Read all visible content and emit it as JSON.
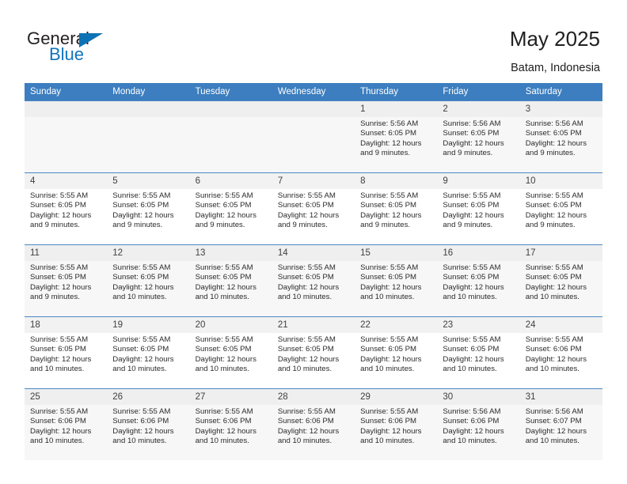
{
  "brand": {
    "name_top": "General",
    "name_bottom": "Blue",
    "triangle_color": "#0e72b5",
    "text_color": "#231f20",
    "blue_color": "#1175bc"
  },
  "header": {
    "title": "May 2025",
    "subtitle": "Batam, Indonesia"
  },
  "theme": {
    "header_row_bg": "#3c7ebf",
    "header_row_text": "#ffffff",
    "row_border": "#4d87c4",
    "shaded_row_bg": "#f7f7f7",
    "daynum_bg": "#f2f2f2"
  },
  "weekday_headers": [
    "Sunday",
    "Monday",
    "Tuesday",
    "Wednesday",
    "Thursday",
    "Friday",
    "Saturday"
  ],
  "weeks": [
    [
      {
        "day": "",
        "sunrise": "",
        "sunset": "",
        "daylight_1": "",
        "daylight_2": "",
        "empty": true
      },
      {
        "day": "",
        "sunrise": "",
        "sunset": "",
        "daylight_1": "",
        "daylight_2": "",
        "empty": true
      },
      {
        "day": "",
        "sunrise": "",
        "sunset": "",
        "daylight_1": "",
        "daylight_2": "",
        "empty": true
      },
      {
        "day": "",
        "sunrise": "",
        "sunset": "",
        "daylight_1": "",
        "daylight_2": "",
        "empty": true
      },
      {
        "day": "1",
        "sunrise": "Sunrise: 5:56 AM",
        "sunset": "Sunset: 6:05 PM",
        "daylight_1": "Daylight: 12 hours",
        "daylight_2": "and 9 minutes."
      },
      {
        "day": "2",
        "sunrise": "Sunrise: 5:56 AM",
        "sunset": "Sunset: 6:05 PM",
        "daylight_1": "Daylight: 12 hours",
        "daylight_2": "and 9 minutes."
      },
      {
        "day": "3",
        "sunrise": "Sunrise: 5:56 AM",
        "sunset": "Sunset: 6:05 PM",
        "daylight_1": "Daylight: 12 hours",
        "daylight_2": "and 9 minutes."
      }
    ],
    [
      {
        "day": "4",
        "sunrise": "Sunrise: 5:55 AM",
        "sunset": "Sunset: 6:05 PM",
        "daylight_1": "Daylight: 12 hours",
        "daylight_2": "and 9 minutes."
      },
      {
        "day": "5",
        "sunrise": "Sunrise: 5:55 AM",
        "sunset": "Sunset: 6:05 PM",
        "daylight_1": "Daylight: 12 hours",
        "daylight_2": "and 9 minutes."
      },
      {
        "day": "6",
        "sunrise": "Sunrise: 5:55 AM",
        "sunset": "Sunset: 6:05 PM",
        "daylight_1": "Daylight: 12 hours",
        "daylight_2": "and 9 minutes."
      },
      {
        "day": "7",
        "sunrise": "Sunrise: 5:55 AM",
        "sunset": "Sunset: 6:05 PM",
        "daylight_1": "Daylight: 12 hours",
        "daylight_2": "and 9 minutes."
      },
      {
        "day": "8",
        "sunrise": "Sunrise: 5:55 AM",
        "sunset": "Sunset: 6:05 PM",
        "daylight_1": "Daylight: 12 hours",
        "daylight_2": "and 9 minutes."
      },
      {
        "day": "9",
        "sunrise": "Sunrise: 5:55 AM",
        "sunset": "Sunset: 6:05 PM",
        "daylight_1": "Daylight: 12 hours",
        "daylight_2": "and 9 minutes."
      },
      {
        "day": "10",
        "sunrise": "Sunrise: 5:55 AM",
        "sunset": "Sunset: 6:05 PM",
        "daylight_1": "Daylight: 12 hours",
        "daylight_2": "and 9 minutes."
      }
    ],
    [
      {
        "day": "11",
        "sunrise": "Sunrise: 5:55 AM",
        "sunset": "Sunset: 6:05 PM",
        "daylight_1": "Daylight: 12 hours",
        "daylight_2": "and 9 minutes."
      },
      {
        "day": "12",
        "sunrise": "Sunrise: 5:55 AM",
        "sunset": "Sunset: 6:05 PM",
        "daylight_1": "Daylight: 12 hours",
        "daylight_2": "and 10 minutes."
      },
      {
        "day": "13",
        "sunrise": "Sunrise: 5:55 AM",
        "sunset": "Sunset: 6:05 PM",
        "daylight_1": "Daylight: 12 hours",
        "daylight_2": "and 10 minutes."
      },
      {
        "day": "14",
        "sunrise": "Sunrise: 5:55 AM",
        "sunset": "Sunset: 6:05 PM",
        "daylight_1": "Daylight: 12 hours",
        "daylight_2": "and 10 minutes."
      },
      {
        "day": "15",
        "sunrise": "Sunrise: 5:55 AM",
        "sunset": "Sunset: 6:05 PM",
        "daylight_1": "Daylight: 12 hours",
        "daylight_2": "and 10 minutes."
      },
      {
        "day": "16",
        "sunrise": "Sunrise: 5:55 AM",
        "sunset": "Sunset: 6:05 PM",
        "daylight_1": "Daylight: 12 hours",
        "daylight_2": "and 10 minutes."
      },
      {
        "day": "17",
        "sunrise": "Sunrise: 5:55 AM",
        "sunset": "Sunset: 6:05 PM",
        "daylight_1": "Daylight: 12 hours",
        "daylight_2": "and 10 minutes."
      }
    ],
    [
      {
        "day": "18",
        "sunrise": "Sunrise: 5:55 AM",
        "sunset": "Sunset: 6:05 PM",
        "daylight_1": "Daylight: 12 hours",
        "daylight_2": "and 10 minutes."
      },
      {
        "day": "19",
        "sunrise": "Sunrise: 5:55 AM",
        "sunset": "Sunset: 6:05 PM",
        "daylight_1": "Daylight: 12 hours",
        "daylight_2": "and 10 minutes."
      },
      {
        "day": "20",
        "sunrise": "Sunrise: 5:55 AM",
        "sunset": "Sunset: 6:05 PM",
        "daylight_1": "Daylight: 12 hours",
        "daylight_2": "and 10 minutes."
      },
      {
        "day": "21",
        "sunrise": "Sunrise: 5:55 AM",
        "sunset": "Sunset: 6:05 PM",
        "daylight_1": "Daylight: 12 hours",
        "daylight_2": "and 10 minutes."
      },
      {
        "day": "22",
        "sunrise": "Sunrise: 5:55 AM",
        "sunset": "Sunset: 6:05 PM",
        "daylight_1": "Daylight: 12 hours",
        "daylight_2": "and 10 minutes."
      },
      {
        "day": "23",
        "sunrise": "Sunrise: 5:55 AM",
        "sunset": "Sunset: 6:05 PM",
        "daylight_1": "Daylight: 12 hours",
        "daylight_2": "and 10 minutes."
      },
      {
        "day": "24",
        "sunrise": "Sunrise: 5:55 AM",
        "sunset": "Sunset: 6:06 PM",
        "daylight_1": "Daylight: 12 hours",
        "daylight_2": "and 10 minutes."
      }
    ],
    [
      {
        "day": "25",
        "sunrise": "Sunrise: 5:55 AM",
        "sunset": "Sunset: 6:06 PM",
        "daylight_1": "Daylight: 12 hours",
        "daylight_2": "and 10 minutes."
      },
      {
        "day": "26",
        "sunrise": "Sunrise: 5:55 AM",
        "sunset": "Sunset: 6:06 PM",
        "daylight_1": "Daylight: 12 hours",
        "daylight_2": "and 10 minutes."
      },
      {
        "day": "27",
        "sunrise": "Sunrise: 5:55 AM",
        "sunset": "Sunset: 6:06 PM",
        "daylight_1": "Daylight: 12 hours",
        "daylight_2": "and 10 minutes."
      },
      {
        "day": "28",
        "sunrise": "Sunrise: 5:55 AM",
        "sunset": "Sunset: 6:06 PM",
        "daylight_1": "Daylight: 12 hours",
        "daylight_2": "and 10 minutes."
      },
      {
        "day": "29",
        "sunrise": "Sunrise: 5:55 AM",
        "sunset": "Sunset: 6:06 PM",
        "daylight_1": "Daylight: 12 hours",
        "daylight_2": "and 10 minutes."
      },
      {
        "day": "30",
        "sunrise": "Sunrise: 5:56 AM",
        "sunset": "Sunset: 6:06 PM",
        "daylight_1": "Daylight: 12 hours",
        "daylight_2": "and 10 minutes."
      },
      {
        "day": "31",
        "sunrise": "Sunrise: 5:56 AM",
        "sunset": "Sunset: 6:07 PM",
        "daylight_1": "Daylight: 12 hours",
        "daylight_2": "and 10 minutes."
      }
    ]
  ]
}
